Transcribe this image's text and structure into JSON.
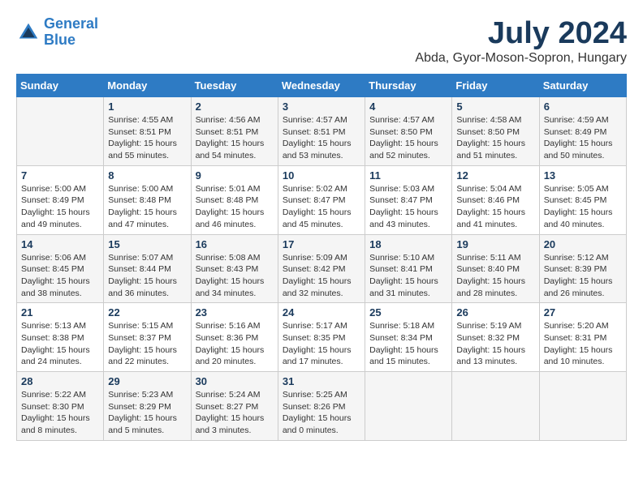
{
  "logo": {
    "line1": "General",
    "line2": "Blue"
  },
  "title": "July 2024",
  "location": "Abda, Gyor-Moson-Sopron, Hungary",
  "days_of_week": [
    "Sunday",
    "Monday",
    "Tuesday",
    "Wednesday",
    "Thursday",
    "Friday",
    "Saturday"
  ],
  "weeks": [
    [
      {
        "day": "",
        "sunrise": "",
        "sunset": "",
        "daylight": ""
      },
      {
        "day": "1",
        "sunrise": "Sunrise: 4:55 AM",
        "sunset": "Sunset: 8:51 PM",
        "daylight": "Daylight: 15 hours and 55 minutes."
      },
      {
        "day": "2",
        "sunrise": "Sunrise: 4:56 AM",
        "sunset": "Sunset: 8:51 PM",
        "daylight": "Daylight: 15 hours and 54 minutes."
      },
      {
        "day": "3",
        "sunrise": "Sunrise: 4:57 AM",
        "sunset": "Sunset: 8:51 PM",
        "daylight": "Daylight: 15 hours and 53 minutes."
      },
      {
        "day": "4",
        "sunrise": "Sunrise: 4:57 AM",
        "sunset": "Sunset: 8:50 PM",
        "daylight": "Daylight: 15 hours and 52 minutes."
      },
      {
        "day": "5",
        "sunrise": "Sunrise: 4:58 AM",
        "sunset": "Sunset: 8:50 PM",
        "daylight": "Daylight: 15 hours and 51 minutes."
      },
      {
        "day": "6",
        "sunrise": "Sunrise: 4:59 AM",
        "sunset": "Sunset: 8:49 PM",
        "daylight": "Daylight: 15 hours and 50 minutes."
      }
    ],
    [
      {
        "day": "7",
        "sunrise": "Sunrise: 5:00 AM",
        "sunset": "Sunset: 8:49 PM",
        "daylight": "Daylight: 15 hours and 49 minutes."
      },
      {
        "day": "8",
        "sunrise": "Sunrise: 5:00 AM",
        "sunset": "Sunset: 8:48 PM",
        "daylight": "Daylight: 15 hours and 47 minutes."
      },
      {
        "day": "9",
        "sunrise": "Sunrise: 5:01 AM",
        "sunset": "Sunset: 8:48 PM",
        "daylight": "Daylight: 15 hours and 46 minutes."
      },
      {
        "day": "10",
        "sunrise": "Sunrise: 5:02 AM",
        "sunset": "Sunset: 8:47 PM",
        "daylight": "Daylight: 15 hours and 45 minutes."
      },
      {
        "day": "11",
        "sunrise": "Sunrise: 5:03 AM",
        "sunset": "Sunset: 8:47 PM",
        "daylight": "Daylight: 15 hours and 43 minutes."
      },
      {
        "day": "12",
        "sunrise": "Sunrise: 5:04 AM",
        "sunset": "Sunset: 8:46 PM",
        "daylight": "Daylight: 15 hours and 41 minutes."
      },
      {
        "day": "13",
        "sunrise": "Sunrise: 5:05 AM",
        "sunset": "Sunset: 8:45 PM",
        "daylight": "Daylight: 15 hours and 40 minutes."
      }
    ],
    [
      {
        "day": "14",
        "sunrise": "Sunrise: 5:06 AM",
        "sunset": "Sunset: 8:45 PM",
        "daylight": "Daylight: 15 hours and 38 minutes."
      },
      {
        "day": "15",
        "sunrise": "Sunrise: 5:07 AM",
        "sunset": "Sunset: 8:44 PM",
        "daylight": "Daylight: 15 hours and 36 minutes."
      },
      {
        "day": "16",
        "sunrise": "Sunrise: 5:08 AM",
        "sunset": "Sunset: 8:43 PM",
        "daylight": "Daylight: 15 hours and 34 minutes."
      },
      {
        "day": "17",
        "sunrise": "Sunrise: 5:09 AM",
        "sunset": "Sunset: 8:42 PM",
        "daylight": "Daylight: 15 hours and 32 minutes."
      },
      {
        "day": "18",
        "sunrise": "Sunrise: 5:10 AM",
        "sunset": "Sunset: 8:41 PM",
        "daylight": "Daylight: 15 hours and 31 minutes."
      },
      {
        "day": "19",
        "sunrise": "Sunrise: 5:11 AM",
        "sunset": "Sunset: 8:40 PM",
        "daylight": "Daylight: 15 hours and 28 minutes."
      },
      {
        "day": "20",
        "sunrise": "Sunrise: 5:12 AM",
        "sunset": "Sunset: 8:39 PM",
        "daylight": "Daylight: 15 hours and 26 minutes."
      }
    ],
    [
      {
        "day": "21",
        "sunrise": "Sunrise: 5:13 AM",
        "sunset": "Sunset: 8:38 PM",
        "daylight": "Daylight: 15 hours and 24 minutes."
      },
      {
        "day": "22",
        "sunrise": "Sunrise: 5:15 AM",
        "sunset": "Sunset: 8:37 PM",
        "daylight": "Daylight: 15 hours and 22 minutes."
      },
      {
        "day": "23",
        "sunrise": "Sunrise: 5:16 AM",
        "sunset": "Sunset: 8:36 PM",
        "daylight": "Daylight: 15 hours and 20 minutes."
      },
      {
        "day": "24",
        "sunrise": "Sunrise: 5:17 AM",
        "sunset": "Sunset: 8:35 PM",
        "daylight": "Daylight: 15 hours and 17 minutes."
      },
      {
        "day": "25",
        "sunrise": "Sunrise: 5:18 AM",
        "sunset": "Sunset: 8:34 PM",
        "daylight": "Daylight: 15 hours and 15 minutes."
      },
      {
        "day": "26",
        "sunrise": "Sunrise: 5:19 AM",
        "sunset": "Sunset: 8:32 PM",
        "daylight": "Daylight: 15 hours and 13 minutes."
      },
      {
        "day": "27",
        "sunrise": "Sunrise: 5:20 AM",
        "sunset": "Sunset: 8:31 PM",
        "daylight": "Daylight: 15 hours and 10 minutes."
      }
    ],
    [
      {
        "day": "28",
        "sunrise": "Sunrise: 5:22 AM",
        "sunset": "Sunset: 8:30 PM",
        "daylight": "Daylight: 15 hours and 8 minutes."
      },
      {
        "day": "29",
        "sunrise": "Sunrise: 5:23 AM",
        "sunset": "Sunset: 8:29 PM",
        "daylight": "Daylight: 15 hours and 5 minutes."
      },
      {
        "day": "30",
        "sunrise": "Sunrise: 5:24 AM",
        "sunset": "Sunset: 8:27 PM",
        "daylight": "Daylight: 15 hours and 3 minutes."
      },
      {
        "day": "31",
        "sunrise": "Sunrise: 5:25 AM",
        "sunset": "Sunset: 8:26 PM",
        "daylight": "Daylight: 15 hours and 0 minutes."
      },
      {
        "day": "",
        "sunrise": "",
        "sunset": "",
        "daylight": ""
      },
      {
        "day": "",
        "sunrise": "",
        "sunset": "",
        "daylight": ""
      },
      {
        "day": "",
        "sunrise": "",
        "sunset": "",
        "daylight": ""
      }
    ]
  ]
}
